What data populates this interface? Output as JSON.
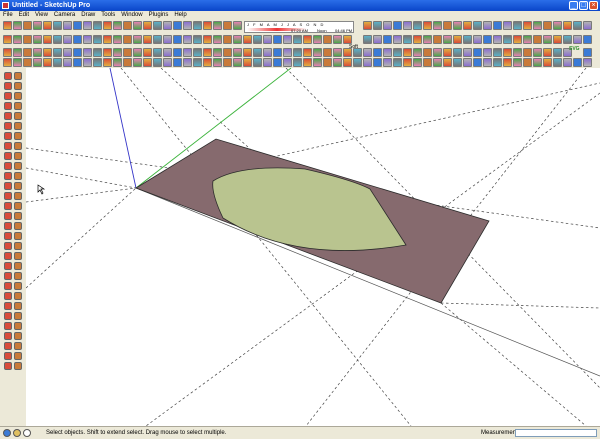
{
  "window": {
    "title": "Untitled - SketchUp Pro"
  },
  "menu": [
    "File",
    "Edit",
    "View",
    "Camera",
    "Draw",
    "Tools",
    "Window",
    "Plugins",
    "Help"
  ],
  "timezone": {
    "months": "J F M A M J J A S O N D",
    "time_start": "07:20 AM",
    "noon": "Noon",
    "time_end": "04:46 PM"
  },
  "toolbar": {
    "soften_label": "Soft",
    "svg_label": "SVG"
  },
  "status": {
    "hint": "Select objects. Shift to extend select. Drag mouse to select multiple.",
    "measurements_label": "Measurements",
    "measurements_value": ""
  },
  "colors": {
    "rect_face": "#866a6e",
    "sector_face": "#b9c48f",
    "green_axis": "#3bb33b",
    "blue_axis": "#3535c8"
  },
  "icons": [
    "app-icon",
    "select-icon",
    "paint-icon",
    "eraser-icon",
    "pencil-icon",
    "rectangle-icon",
    "circle-icon",
    "arc-icon",
    "push-pull-icon",
    "move-icon",
    "rotate-icon",
    "scale-icon",
    "offset-icon",
    "tape-measure-icon",
    "dimension-icon",
    "text-icon",
    "axes-icon",
    "orbit-icon",
    "pan-icon",
    "zoom-icon",
    "zoom-extents-icon",
    "walk-icon",
    "look-around-icon",
    "section-plane-icon",
    "house-icon",
    "geo-location-icon",
    "help-icon"
  ]
}
